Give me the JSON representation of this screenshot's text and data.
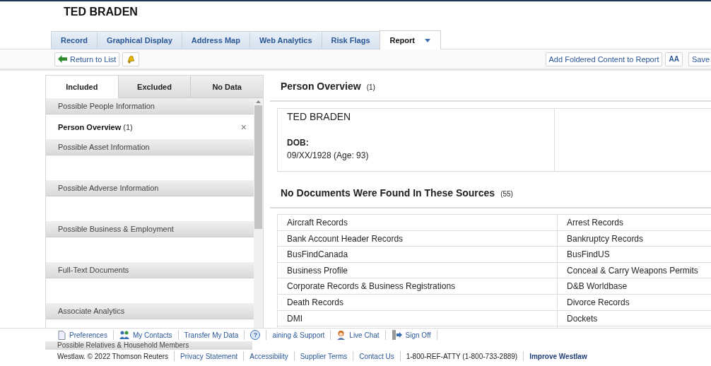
{
  "header": {
    "title": "TED BRADEN"
  },
  "tabs": [
    {
      "label": "Record",
      "selected": false,
      "dropdown": false
    },
    {
      "label": "Graphical Display",
      "selected": false,
      "dropdown": false
    },
    {
      "label": "Address Map",
      "selected": false,
      "dropdown": false
    },
    {
      "label": "Web Analytics",
      "selected": false,
      "dropdown": false
    },
    {
      "label": "Risk Flags",
      "selected": false,
      "dropdown": false
    },
    {
      "label": "Report",
      "selected": true,
      "dropdown": true
    }
  ],
  "toolbar": {
    "return_button": "Return to List",
    "add_button": "Add Foldered Content to Report",
    "font_button": "AA",
    "save_button": "Save"
  },
  "left_panel": {
    "tabs": [
      {
        "label": "Included",
        "selected": true
      },
      {
        "label": "Excluded",
        "selected": false
      },
      {
        "label": "No Data",
        "selected": false
      }
    ],
    "sections": [
      {
        "heading": "Possible People Information",
        "items": [
          {
            "label": "Person Overview",
            "count": "(1)",
            "remove": "×"
          }
        ]
      },
      {
        "heading": "Possible Asset Information"
      },
      {
        "heading": "Possible Adverse Information"
      },
      {
        "heading": "Possible Business & Employment"
      },
      {
        "heading": "Full-Text Documents"
      },
      {
        "heading": "Associate Analytics"
      }
    ],
    "last_heading": "Possible Relatives & Household Members"
  },
  "overview": {
    "heading": "Person Overview",
    "count": "(1)",
    "name": "TED BRADEN",
    "dob_label": "DOB:",
    "dob_value": "09/XX/1928 (Age: 93)"
  },
  "no_documents": {
    "heading": "No Documents Were Found In These Sources",
    "count": "(55)",
    "rows": [
      [
        "Aircraft Records",
        "Arrest Records"
      ],
      [
        "Bank Account Header Records",
        "Bankruptcy Records"
      ],
      [
        "BusFindCanada",
        "BusFindUS"
      ],
      [
        "Business Profile",
        "Conceal & Carry Weapons Permits"
      ],
      [
        "Corporate Records & Business Registrations",
        "D&B Worldbase"
      ],
      [
        "Death Records",
        "Divorce Records"
      ],
      [
        "DMI",
        "Dockets"
      ]
    ]
  },
  "footer_links": [
    {
      "label": "Preferences",
      "kind": "page"
    },
    {
      "label": "My Contacts",
      "kind": "people"
    },
    {
      "label": "Transfer My Data",
      "kind": "plain"
    },
    {
      "label": "?",
      "kind": "help"
    },
    {
      "label": "aining & Support",
      "kind": "plain"
    },
    {
      "label": "Live Chat",
      "kind": "person"
    },
    {
      "label": "Sign Off",
      "kind": "door"
    }
  ],
  "bottom_footer": [
    {
      "text": "Westlaw. © 2022 Thomson Reuters",
      "kind": "text"
    },
    {
      "text": "Privacy Statement",
      "kind": "link"
    },
    {
      "text": "Accessibility",
      "kind": "link"
    },
    {
      "text": "Supplier Terms",
      "kind": "link"
    },
    {
      "text": "Contact Us",
      "kind": "link"
    },
    {
      "text": "1-800-REF-ATTY (1-800-733-2889)",
      "kind": "text"
    },
    {
      "text": "Improve Westlaw",
      "kind": "strong-link"
    }
  ]
}
